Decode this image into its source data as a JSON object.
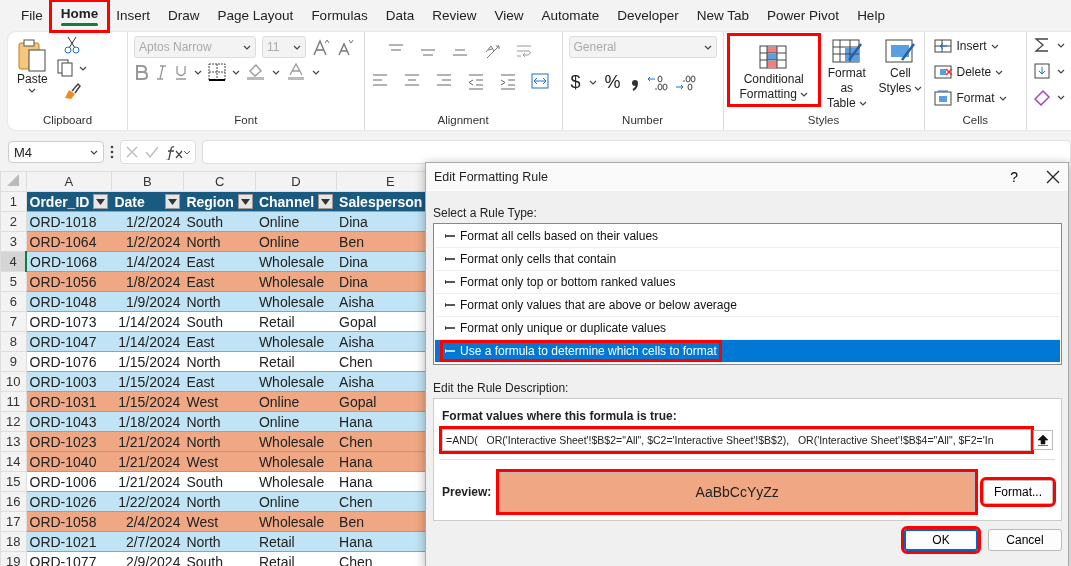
{
  "menu_tabs": [
    {
      "label": "File",
      "selected": false,
      "highlighted": false
    },
    {
      "label": "Home",
      "selected": true,
      "highlighted": true
    },
    {
      "label": "Insert",
      "selected": false,
      "highlighted": false
    },
    {
      "label": "Draw",
      "selected": false,
      "highlighted": false
    },
    {
      "label": "Page Layout",
      "selected": false,
      "highlighted": false
    },
    {
      "label": "Formulas",
      "selected": false,
      "highlighted": false
    },
    {
      "label": "Data",
      "selected": false,
      "highlighted": false
    },
    {
      "label": "Review",
      "selected": false,
      "highlighted": false
    },
    {
      "label": "View",
      "selected": false,
      "highlighted": false
    },
    {
      "label": "Automate",
      "selected": false,
      "highlighted": false
    },
    {
      "label": "Developer",
      "selected": false,
      "highlighted": false
    },
    {
      "label": "New Tab",
      "selected": false,
      "highlighted": false
    },
    {
      "label": "Power Pivot",
      "selected": false,
      "highlighted": false
    },
    {
      "label": "Help",
      "selected": false,
      "highlighted": false
    }
  ],
  "ribbon": {
    "groups": [
      {
        "kind": "clipboard",
        "label": "Clipboard",
        "paste": "Paste"
      },
      {
        "kind": "font",
        "label": "Font",
        "font_name": "Aptos Narrow",
        "font_size": "11",
        "disabled": true
      },
      {
        "kind": "alignment",
        "label": "Alignment"
      },
      {
        "kind": "number",
        "label": "Number",
        "format": "General",
        "disabled": true,
        "symbols": [
          "$",
          "%"
        ]
      },
      {
        "kind": "styles",
        "label": "Styles",
        "buttons": [
          {
            "lines": [
              "Conditional",
              "Formatting"
            ],
            "highlighted": true
          },
          {
            "lines": [
              "Format as",
              "Table"
            ],
            "highlighted": false
          },
          {
            "lines": [
              "Cell",
              "Styles"
            ],
            "highlighted": false
          }
        ]
      },
      {
        "kind": "cells",
        "label": "Cells",
        "buttons": [
          "Insert",
          "Delete",
          "Format"
        ]
      },
      {
        "kind": "editing"
      }
    ]
  },
  "name_box": "M4",
  "sheet": {
    "columns": [
      "A",
      "B",
      "C",
      "D",
      "E"
    ],
    "header_row": "1",
    "header": [
      "Order_ID",
      "Date",
      "Region",
      "Channel",
      "Salesperson"
    ],
    "rows": [
      {
        "n": "2",
        "selected": false,
        "color": "#c0e4f5",
        "cells": [
          "ORD-1018",
          "1/2/2024",
          "South",
          "Online",
          "Dina"
        ]
      },
      {
        "n": "3",
        "selected": false,
        "color": "#f0a884",
        "cells": [
          "ORD-1064",
          "1/2/2024",
          "North",
          "Online",
          "Ben"
        ]
      },
      {
        "n": "4",
        "selected": true,
        "color": "#c0e4f5",
        "cells": [
          "ORD-1068",
          "1/4/2024",
          "East",
          "Wholesale",
          "Dina"
        ]
      },
      {
        "n": "5",
        "selected": false,
        "color": "#f0a884",
        "cells": [
          "ORD-1056",
          "1/8/2024",
          "East",
          "Wholesale",
          "Dina"
        ]
      },
      {
        "n": "6",
        "selected": false,
        "color": "#c0e4f5",
        "cells": [
          "ORD-1048",
          "1/9/2024",
          "North",
          "Wholesale",
          "Aisha"
        ]
      },
      {
        "n": "7",
        "selected": false,
        "color": "#ffffff",
        "cells": [
          "ORD-1073",
          "1/14/2024",
          "South",
          "Retail",
          "Gopal"
        ]
      },
      {
        "n": "8",
        "selected": false,
        "color": "#c0e4f5",
        "cells": [
          "ORD-1047",
          "1/14/2024",
          "East",
          "Wholesale",
          "Aisha"
        ]
      },
      {
        "n": "9",
        "selected": false,
        "color": "#ffffff",
        "cells": [
          "ORD-1076",
          "1/15/2024",
          "North",
          "Retail",
          "Chen"
        ]
      },
      {
        "n": "10",
        "selected": false,
        "color": "#c0e4f5",
        "cells": [
          "ORD-1003",
          "1/15/2024",
          "East",
          "Wholesale",
          "Aisha"
        ]
      },
      {
        "n": "11",
        "selected": false,
        "color": "#f0a884",
        "cells": [
          "ORD-1031",
          "1/15/2024",
          "West",
          "Online",
          "Gopal"
        ]
      },
      {
        "n": "12",
        "selected": false,
        "color": "#c0e4f5",
        "cells": [
          "ORD-1043",
          "1/18/2024",
          "North",
          "Online",
          "Hana"
        ]
      },
      {
        "n": "13",
        "selected": false,
        "color": "#f0a884",
        "cells": [
          "ORD-1023",
          "1/21/2024",
          "North",
          "Wholesale",
          "Chen"
        ]
      },
      {
        "n": "14",
        "selected": false,
        "color": "#f0a884",
        "cells": [
          "ORD-1040",
          "1/21/2024",
          "West",
          "Wholesale",
          "Hana"
        ]
      },
      {
        "n": "15",
        "selected": false,
        "color": "#ffffff",
        "cells": [
          "ORD-1006",
          "1/21/2024",
          "South",
          "Wholesale",
          "Hana"
        ]
      },
      {
        "n": "16",
        "selected": false,
        "color": "#c0e4f5",
        "cells": [
          "ORD-1026",
          "1/22/2024",
          "North",
          "Online",
          "Chen"
        ]
      },
      {
        "n": "17",
        "selected": false,
        "color": "#f0a884",
        "cells": [
          "ORD-1058",
          "2/4/2024",
          "West",
          "Wholesale",
          "Ben"
        ]
      },
      {
        "n": "18",
        "selected": false,
        "color": "#c0e4f5",
        "cells": [
          "ORD-1021",
          "2/7/2024",
          "North",
          "Retail",
          "Hana"
        ]
      },
      {
        "n": "19",
        "selected": false,
        "color": "#ffffff",
        "cells": [
          "ORD-1077",
          "2/9/2024",
          "South",
          "Retail",
          "Chen"
        ]
      }
    ]
  },
  "dialog": {
    "title": "Edit Formatting Rule",
    "help": "?",
    "rule_type_label": "Select a Rule Type:",
    "rule_types": [
      {
        "label": "Format all cells based on their values",
        "selected": false,
        "highlighted": false
      },
      {
        "label": "Format only cells that contain",
        "selected": false,
        "highlighted": false
      },
      {
        "label": "Format only top or bottom ranked values",
        "selected": false,
        "highlighted": false
      },
      {
        "label": "Format only values that are above or below average",
        "selected": false,
        "highlighted": false
      },
      {
        "label": "Format only unique or duplicate values",
        "selected": false,
        "highlighted": false
      },
      {
        "label": "Use a formula to determine which cells to format",
        "selected": true,
        "highlighted": true
      }
    ],
    "description_label": "Edit the Rule Description:",
    "formula_label": "Format values where this formula is true:",
    "formula": {
      "value": "=AND(   OR('Interactive Sheet'!$B$2=\"All\", $C2='Interactive Sheet'!$B$2),   OR('Interactive Sheet'!$B$4=\"All\", $F2='In",
      "highlighted": true
    },
    "preview_label": "Preview:",
    "preview": {
      "text": "AaBbCcYyZz",
      "color": "#f0a884",
      "highlighted": true
    },
    "format_button": {
      "label": "Format...",
      "highlighted": true
    },
    "buttons": [
      {
        "label": "OK",
        "kind": "primary",
        "highlighted": true
      },
      {
        "label": "Cancel",
        "kind": "secondary",
        "highlighted": false
      }
    ]
  }
}
